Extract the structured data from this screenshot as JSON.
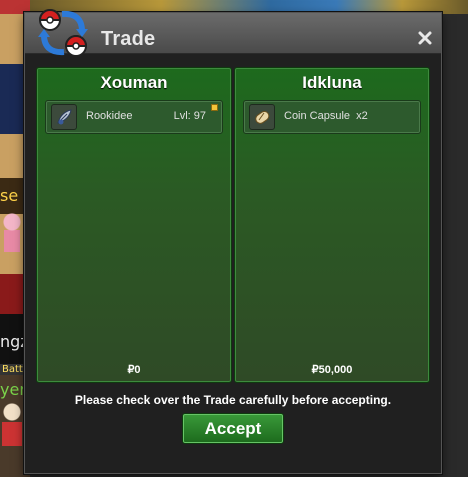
{
  "window": {
    "title": "Trade",
    "close_icon": "close-icon",
    "logo_icon": "pokeball-trade-icon"
  },
  "background": {
    "fragment_1": "se",
    "fragment_2": "ngz",
    "fragment_3": "Battle",
    "fragment_4": "yer"
  },
  "left_panel": {
    "player": "Xouman",
    "item": {
      "icon": "feather-icon",
      "name": "Rookidee",
      "level": "Lvl: 97"
    },
    "money": "₽0"
  },
  "right_panel": {
    "player": "Idkluna",
    "item": {
      "icon": "capsule-icon",
      "name": "Coin Capsule",
      "quantity": "x2"
    },
    "money": "₽50,000"
  },
  "notice": "Please check over the Trade carefully before accepting.",
  "accept_label": "Accept",
  "colors": {
    "panel_green": "#2b5a24",
    "accent_green": "#2f8a2f",
    "titlebar": "#5a5a5a"
  }
}
